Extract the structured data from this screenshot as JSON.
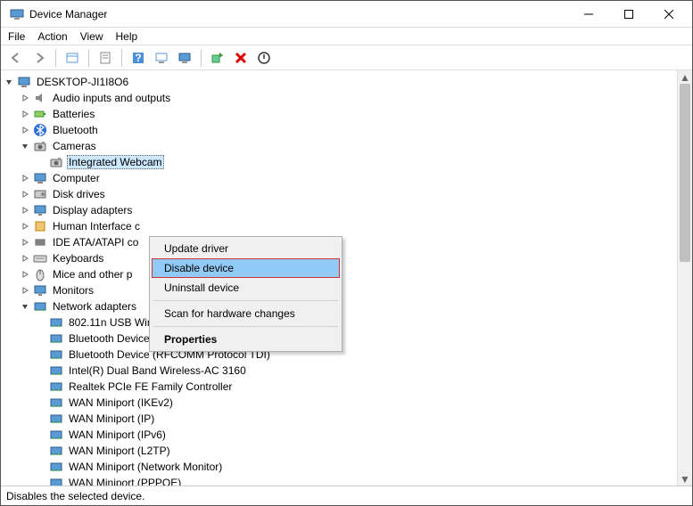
{
  "window": {
    "title": "Device Manager"
  },
  "menu": {
    "file": "File",
    "action": "Action",
    "view": "View",
    "help": "Help"
  },
  "toolbar_icons": [
    "back",
    "forward",
    "show-hidden",
    "properties",
    "help",
    "update",
    "monitor",
    "scan",
    "delete",
    "enable"
  ],
  "tree": {
    "root": "DESKTOP-JI1I8O6",
    "nodes": [
      {
        "label": "Audio inputs and outputs",
        "icon": "audio",
        "expanded": false
      },
      {
        "label": "Batteries",
        "icon": "battery",
        "expanded": false
      },
      {
        "label": "Bluetooth",
        "icon": "bluetooth",
        "expanded": false
      },
      {
        "label": "Cameras",
        "icon": "camera",
        "expanded": true,
        "children": [
          {
            "label": "Integrated Webcam",
            "icon": "camera",
            "selected": true
          }
        ]
      },
      {
        "label": "Computer",
        "icon": "computer",
        "expanded": false
      },
      {
        "label": "Disk drives",
        "icon": "disk",
        "expanded": false
      },
      {
        "label": "Display adapters",
        "icon": "display",
        "expanded": false
      },
      {
        "label": "Human Interface c",
        "icon": "hid",
        "expanded": false,
        "truncated": true
      },
      {
        "label": "IDE ATA/ATAPI co",
        "icon": "ide",
        "expanded": false,
        "truncated": true
      },
      {
        "label": "Keyboards",
        "icon": "keyboard",
        "expanded": false
      },
      {
        "label": "Mice and other p",
        "icon": "mouse",
        "expanded": false,
        "truncated": true
      },
      {
        "label": "Monitors",
        "icon": "monitor",
        "expanded": false
      },
      {
        "label": "Network adapters",
        "icon": "network",
        "expanded": true,
        "children": [
          {
            "label": "802.11n USB Wireless LAN Card",
            "icon": "network"
          },
          {
            "label": "Bluetooth Device (Personal Area Network)",
            "icon": "network"
          },
          {
            "label": "Bluetooth Device (RFCOMM Protocol TDI)",
            "icon": "network"
          },
          {
            "label": "Intel(R) Dual Band Wireless-AC 3160",
            "icon": "network"
          },
          {
            "label": "Realtek PCIe FE Family Controller",
            "icon": "network"
          },
          {
            "label": "WAN Miniport (IKEv2)",
            "icon": "network"
          },
          {
            "label": "WAN Miniport (IP)",
            "icon": "network"
          },
          {
            "label": "WAN Miniport (IPv6)",
            "icon": "network"
          },
          {
            "label": "WAN Miniport (L2TP)",
            "icon": "network"
          },
          {
            "label": "WAN Miniport (Network Monitor)",
            "icon": "network"
          },
          {
            "label": "WAN Miniport (PPPOE)",
            "icon": "network"
          }
        ]
      }
    ]
  },
  "context_menu": {
    "items": [
      {
        "label": "Update driver",
        "type": "item"
      },
      {
        "label": "Disable device",
        "type": "item",
        "highlighted": true
      },
      {
        "label": "Uninstall device",
        "type": "item"
      },
      {
        "type": "sep"
      },
      {
        "label": "Scan for hardware changes",
        "type": "item"
      },
      {
        "type": "sep"
      },
      {
        "label": "Properties",
        "type": "item",
        "bold": true
      }
    ]
  },
  "statusbar": "Disables the selected device."
}
